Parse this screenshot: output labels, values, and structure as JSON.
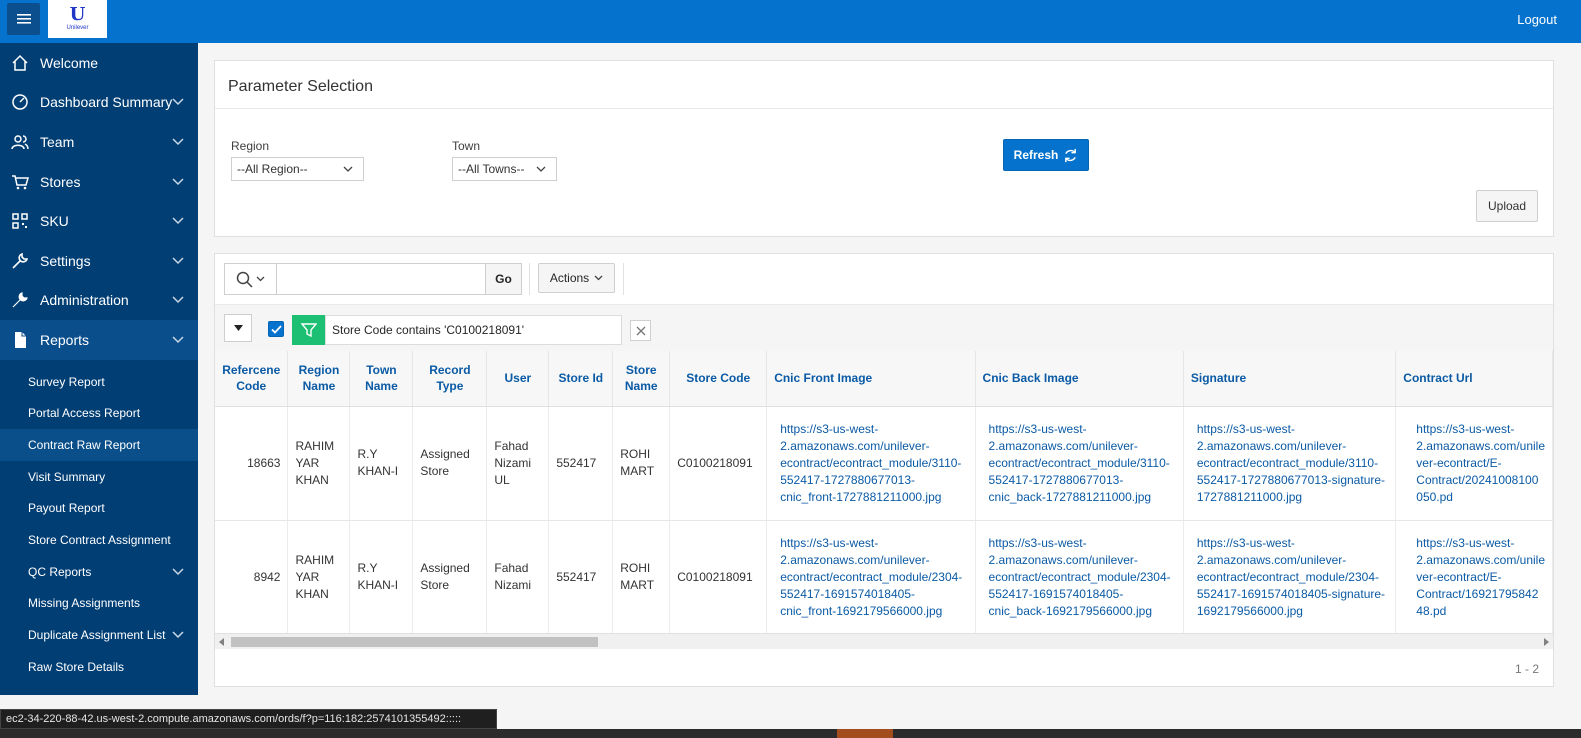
{
  "header": {
    "logo_text": "Unilever",
    "logout_label": "Logout"
  },
  "sidebar": {
    "items": [
      {
        "label": "Welcome",
        "icon": "home-icon"
      },
      {
        "label": "Dashboard Summary",
        "icon": "dashboard-icon"
      },
      {
        "label": "Team",
        "icon": "users-icon"
      },
      {
        "label": "Stores",
        "icon": "cart-icon"
      },
      {
        "label": "SKU",
        "icon": "qr-code-icon"
      },
      {
        "label": "Settings",
        "icon": "wrench-icon"
      },
      {
        "label": "Administration",
        "icon": "wrench-screwdriver-icon"
      },
      {
        "label": "Reports",
        "icon": "file-icon"
      }
    ],
    "subitems": [
      {
        "label": "Survey Report"
      },
      {
        "label": "Portal Access Report"
      },
      {
        "label": "Contract Raw Report"
      },
      {
        "label": "Visit Summary"
      },
      {
        "label": "Payout Report"
      },
      {
        "label": "Store Contract Assignment"
      },
      {
        "label": "QC Reports"
      },
      {
        "label": "Missing Assignments"
      },
      {
        "label": "Duplicate Assignment List"
      },
      {
        "label": "Raw Store Details"
      }
    ]
  },
  "params": {
    "title": "Parameter Selection",
    "region_label": "Region",
    "region_value": "--All Region--",
    "town_label": "Town",
    "town_value": "--All Towns--",
    "refresh_label": "Refresh",
    "upload_label": "Upload"
  },
  "report": {
    "go_label": "Go",
    "actions_label": "Actions",
    "search_value": "",
    "filter_text": "Store Code contains 'C0100218091'",
    "columns": [
      "Refercene Code",
      "Region Name",
      "Town Name",
      "Record Type",
      "User",
      "Store Id",
      "Store Name",
      "Store Code",
      "Cnic Front Image",
      "Cnic Back Image",
      "Signature",
      "Contract Url"
    ],
    "rows": [
      {
        "ref": "18663",
        "region": "RAHIM YAR KHAN",
        "town": "R.Y KHAN-I",
        "record": "Assigned Store",
        "user": "Fahad Nizami UL",
        "store_id": "552417",
        "store_name": "ROHI MART",
        "store_code": "C0100218091",
        "cnic_front": "https://s3-us-west-2.amazonaws.com/unilever-econtract/econtract_module/3110-552417-1727880677013-cnic_front-1727881211000.jpg",
        "cnic_back": "https://s3-us-west-2.amazonaws.com/unilever-econtract/econtract_module/3110-552417-1727880677013-cnic_back-1727881211000.jpg",
        "signature": "https://s3-us-west-2.amazonaws.com/unilever-econtract/econtract_module/3110-552417-1727880677013-signature-1727881211000.jpg",
        "contract": "https://s3-us-west-2.amazonaws.com/unilever-econtract/E-Contract/20241008100050.pd"
      },
      {
        "ref": "8942",
        "region": "RAHIM YAR KHAN",
        "town": "R.Y KHAN-I",
        "record": "Assigned Store",
        "user": "Fahad Nizami",
        "store_id": "552417",
        "store_name": "ROHI MART",
        "store_code": "C0100218091",
        "cnic_front": "https://s3-us-west-2.amazonaws.com/unilever-econtract/econtract_module/2304-552417-1691574018405-cnic_front-1692179566000.jpg",
        "cnic_back": "https://s3-us-west-2.amazonaws.com/unilever-econtract/econtract_module/2304-552417-1691574018405-cnic_back-1692179566000.jpg",
        "signature": "https://s3-us-west-2.amazonaws.com/unilever-econtract/econtract_module/2304-552417-1691574018405-signature-1692179566000.jpg",
        "contract": "https://s3-us-west-2.amazonaws.com/unilever-econtract/E-Contract/1692179584248.pd"
      }
    ],
    "pagination": "1 - 2"
  },
  "statusbar": {
    "url": "ec2-34-220-88-42.us-west-2.compute.amazonaws.com/ords/f?p=116:182:2574101355492:::::"
  },
  "colors": {
    "header_blue": "#0572ce",
    "sidebar_navy": "#003e74",
    "link_blue": "#0a5aa5",
    "filter_green": "#1dbf73"
  }
}
